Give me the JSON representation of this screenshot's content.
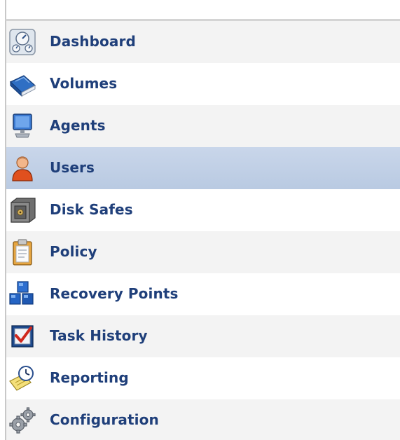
{
  "nav": {
    "items": [
      {
        "label": "Dashboard",
        "icon": "dashboard-icon",
        "selected": false
      },
      {
        "label": "Volumes",
        "icon": "book-icon",
        "selected": false
      },
      {
        "label": "Agents",
        "icon": "monitor-icon",
        "selected": false
      },
      {
        "label": "Users",
        "icon": "user-icon",
        "selected": true
      },
      {
        "label": "Disk Safes",
        "icon": "safe-icon",
        "selected": false
      },
      {
        "label": "Policy",
        "icon": "clipboard-icon",
        "selected": false
      },
      {
        "label": "Recovery Points",
        "icon": "cubes-icon",
        "selected": false
      },
      {
        "label": "Task History",
        "icon": "checkbox-icon",
        "selected": false
      },
      {
        "label": "Reporting",
        "icon": "clock-report-icon",
        "selected": false
      },
      {
        "label": "Configuration",
        "icon": "gears-icon",
        "selected": false
      }
    ]
  },
  "colors": {
    "label": "#1f3f7a",
    "selected_bg": "#c4d2e8",
    "alt_row_bg": "#f3f3f3"
  }
}
